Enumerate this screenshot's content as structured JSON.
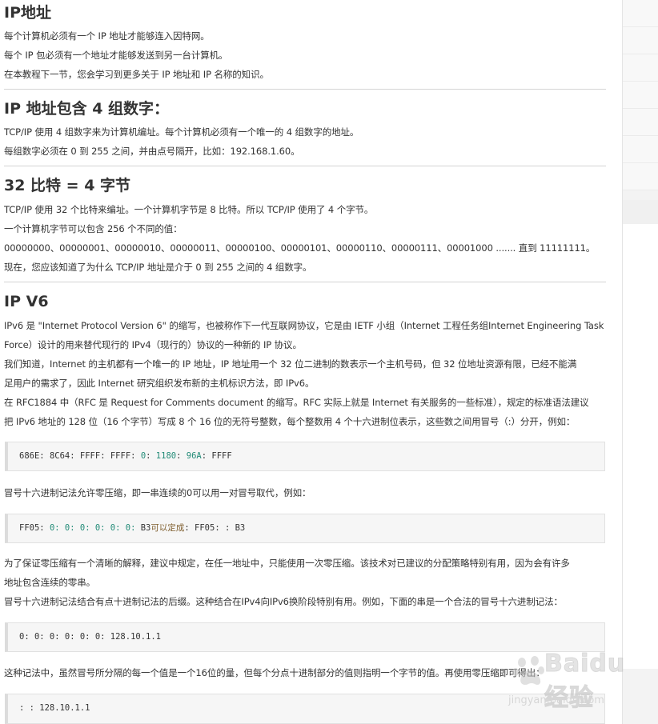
{
  "sections": {
    "ip_address": {
      "title": "IP地址",
      "lines": [
        "每个计算机必须有一个 IP 地址才能够连入因特网。",
        "每个 IP 包必须有一个地址才能够发送到另一台计算机。",
        "在本教程下一节，您会学习到更多关于 IP 地址和 IP 名称的知识。"
      ]
    },
    "four_groups": {
      "title": "IP 地址包含 4 组数字：",
      "lines": [
        "TCP/IP 使用 4 组数字来为计算机编址。每个计算机必须有一个唯一的 4 组数字的地址。",
        "每组数字必须在 0 到 255 之间，并由点号隔开，比如：192.168.1.60。"
      ]
    },
    "bits_bytes": {
      "title": "32 比特 = 4 字节",
      "lines": [
        "TCP/IP 使用 32 个比特来编址。一个计算机字节是 8 比特。所以 TCP/IP 使用了 4 个字节。",
        "一个计算机字节可以包含 256 个不同的值：",
        "00000000、00000001、00000010、00000011、00000100、00000101、00000110、00000111、00001000 ....... 直到 11111111。",
        "现在，您应该知道了为什么 TCP/IP 地址是介于 0 到 255 之间的 4 组数字。"
      ]
    },
    "ipv6": {
      "title": "IP V6",
      "para1_l1": "IPv6 是 \"Internet Protocol Version 6\" 的缩写，也被称作下一代互联网协议，它是由 IETF 小组（Internet 工程任务组Internet Engineering Task",
      "para1_l2": "Force）设计的用来替代现行的 IPv4（现行的）协议的一种新的 IP 协议。",
      "para2_l1": "我们知道，Internet 的主机都有一个唯一的 IP 地址，IP 地址用一个 32 位二进制的数表示一个主机号码，但 32 位地址资源有限，已经不能满",
      "para2_l2": "足用户的需求了，因此 Internet 研究组织发布新的主机标识方法，即 IPv6。",
      "para3_l1": "在 RFC1884 中（RFC 是 Request for Comments document 的缩写。RFC 实际上就是 Internet 有关服务的一些标准），规定的标准语法建议",
      "para3_l2": "把 IPv6 地址的 128 位（16 个字节）写成 8 个 16 位的无符号整数，每个整数用 4 个十六进制位表示，这些数之间用冒号（:）分开，例如：",
      "code1": {
        "seg1": "686E",
        "p1": ": ",
        "seg2": "8C64",
        "p2": ": ",
        "seg3": "FFFF",
        "p3": ": ",
        "seg4": "FFFF",
        "p4": ": ",
        "seg5": "0",
        "p5": ": ",
        "seg6": "1180",
        "p6": ": ",
        "seg7": "96A",
        "p7": ": ",
        "seg8": "FFFF"
      },
      "para4": "冒号十六进制记法允许零压缩，即一串连续的0可以用一对冒号取代，例如：",
      "code2": {
        "a": "FF05: ",
        "zeros": "0: 0: 0: 0: 0: 0: ",
        "b": "B3",
        "cjk": "可以定成",
        "c": ": FF05: : B3"
      },
      "para5_l1": "为了保证零压缩有一个清晰的解释，建议中规定，在任一地址中，只能使用一次零压缩。该技术对已建议的分配策略特别有用，因为会有许多",
      "para5_l2": "地址包含连续的零串。",
      "para6": "冒号十六进制记法结合有点十进制记法的后缀。这种结合在IPv4向IPv6换阶段特别有用。例如，下面的串是一个合法的冒号十六进制记法：",
      "code3": "0: 0: 0: 0: 0: 0: 128.10.1.1",
      "para7": "这种记法中，虽然冒号所分隔的每一个值是一个16位的量，但每个分点十进制部分的值则指明一个字节的值。再使用零压缩即可得出：",
      "code4": ": : 128.10.1.1"
    }
  },
  "watermark": {
    "brand": "Baidu经验",
    "url": "jingyan.baidu.com"
  },
  "colors": {
    "code_number": "#228b77",
    "code_background": "#f6f6f6",
    "separator": "#d4d4d4"
  }
}
